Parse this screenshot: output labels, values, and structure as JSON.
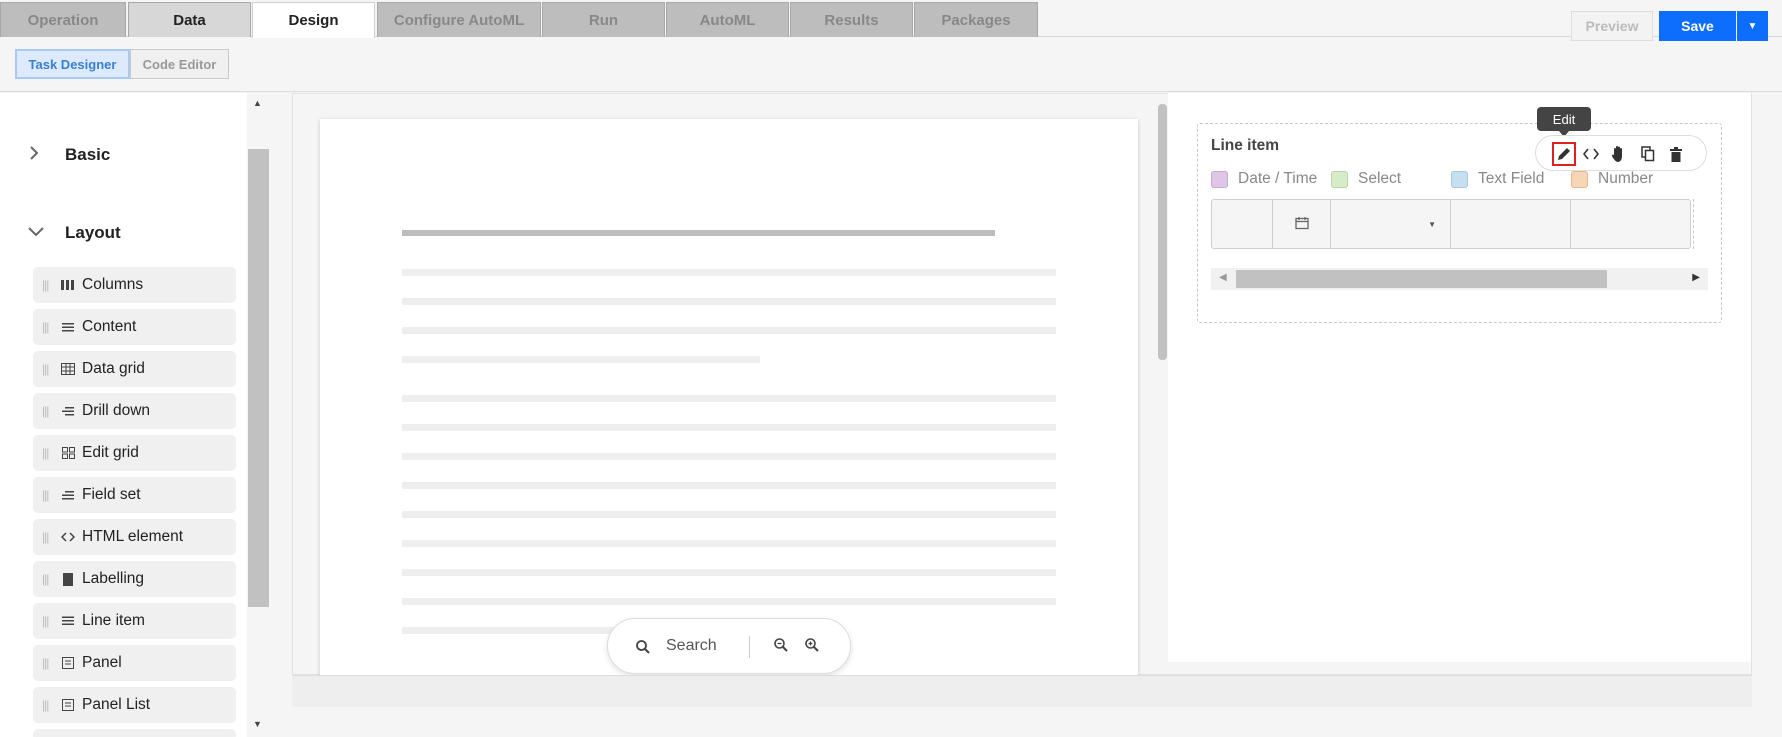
{
  "tabs": [
    {
      "label": "Operation"
    },
    {
      "label": "Data"
    },
    {
      "label": "Design"
    },
    {
      "label": "Configure AutoML"
    },
    {
      "label": "Run"
    },
    {
      "label": "AutoML"
    },
    {
      "label": "Results"
    },
    {
      "label": "Packages"
    }
  ],
  "toolbar": {
    "task_designer": "Task Designer",
    "code_editor": "Code Editor",
    "preview": "Preview",
    "save": "Save"
  },
  "sidebar": {
    "sections": [
      {
        "label": "Basic",
        "state": "collapsed"
      },
      {
        "label": "Layout",
        "state": "expanded"
      }
    ],
    "items": [
      {
        "label": "Columns",
        "icon": "columns-icon"
      },
      {
        "label": "Content",
        "icon": "content-icon"
      },
      {
        "label": "Data grid",
        "icon": "grid-icon"
      },
      {
        "label": "Drill down",
        "icon": "drilldown-icon"
      },
      {
        "label": "Edit grid",
        "icon": "edit-grid-icon"
      },
      {
        "label": "Field set",
        "icon": "fieldset-icon"
      },
      {
        "label": "HTML element",
        "icon": "code-icon"
      },
      {
        "label": "Labelling",
        "icon": "labelling-icon"
      },
      {
        "label": "Line item",
        "icon": "line-item-icon"
      },
      {
        "label": "Panel",
        "icon": "panel-icon"
      },
      {
        "label": "Panel List",
        "icon": "panel-list-icon"
      }
    ]
  },
  "search": {
    "label": "Search"
  },
  "line_item": {
    "title": "Line item",
    "legend": [
      {
        "label": "Date / Time",
        "color": "#e0c6e6"
      },
      {
        "label": "Select",
        "color": "#d6ecc8"
      },
      {
        "label": "Text Field",
        "color": "#c6dff0"
      },
      {
        "label": "Number",
        "color": "#f7d6b5"
      }
    ],
    "tooltip": "Edit"
  },
  "colors": {
    "accent": "#0d6efd",
    "highlight": "#e02020"
  }
}
